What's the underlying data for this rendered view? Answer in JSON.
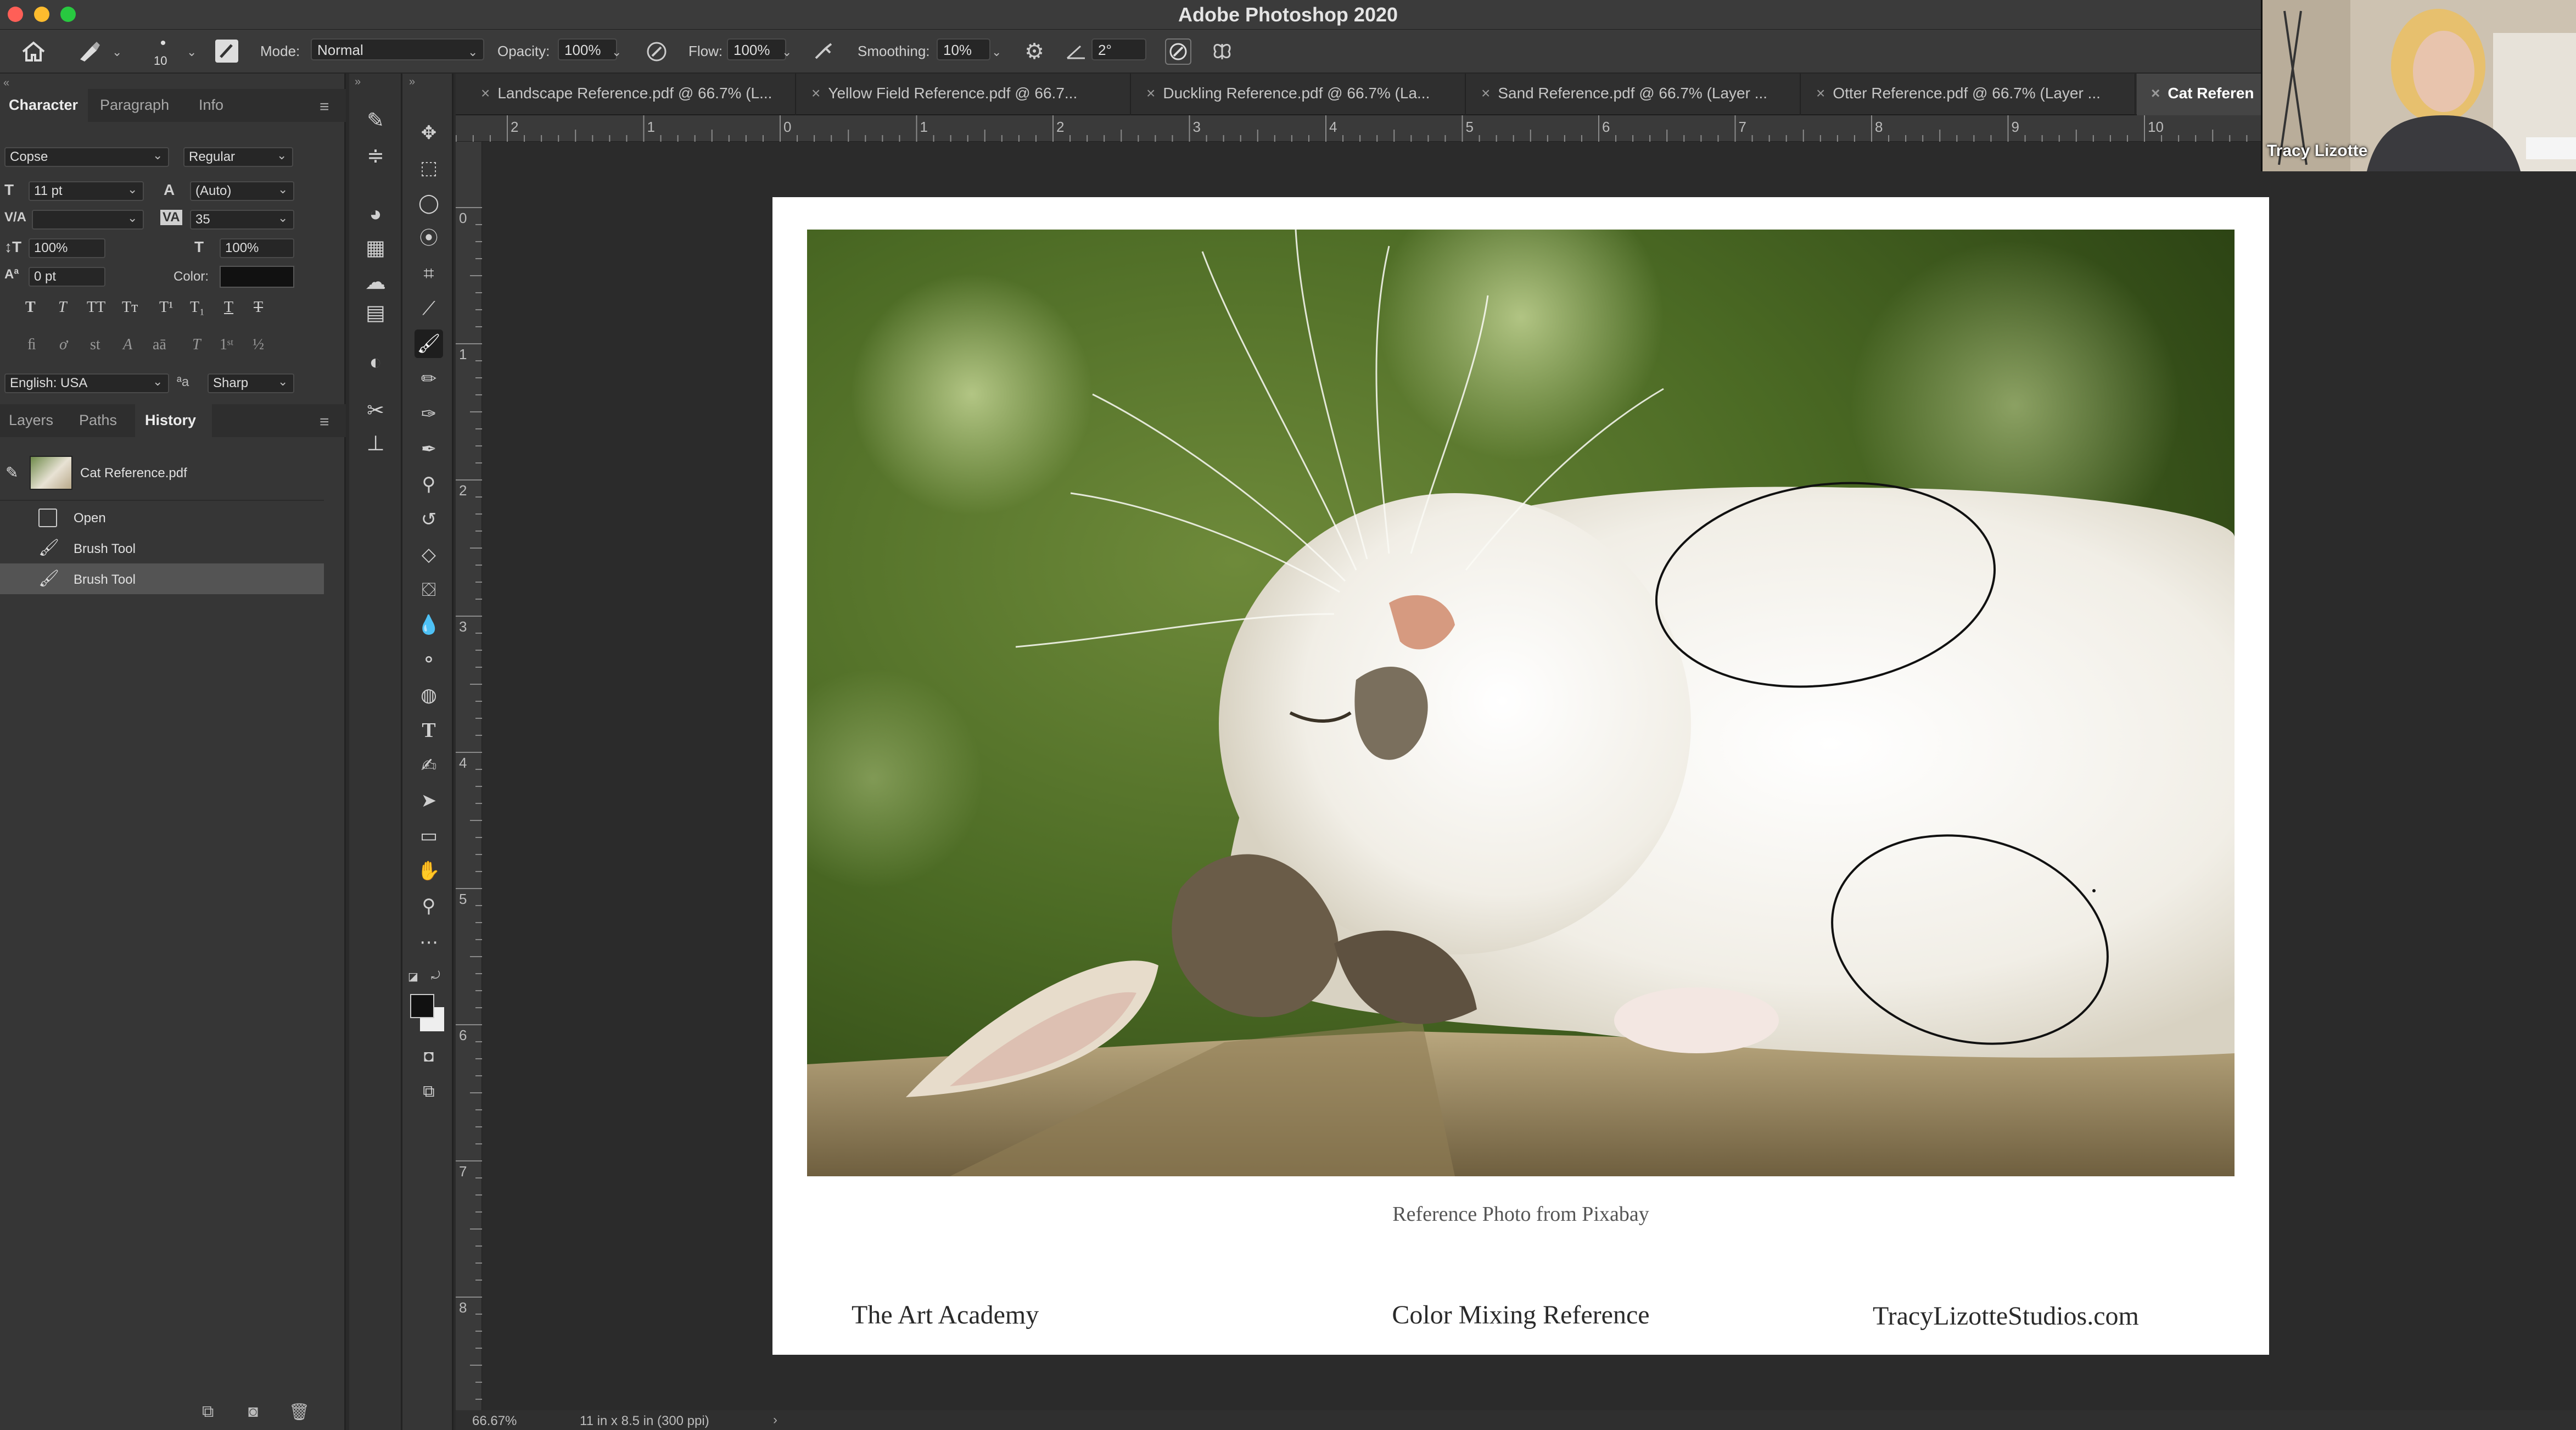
{
  "app": {
    "title": "Adobe Photoshop 2020"
  },
  "options_bar": {
    "brush_size": "10",
    "mode_label": "Mode:",
    "mode_value": "Normal",
    "opacity_label": "Opacity:",
    "opacity_value": "100%",
    "flow_label": "Flow:",
    "flow_value": "100%",
    "smoothing_label": "Smoothing:",
    "smoothing_value": "10%",
    "angle_value": "2°"
  },
  "character_panel": {
    "tabs": [
      "Character",
      "Paragraph",
      "Info"
    ],
    "font_family": "Copse",
    "font_style": "Regular",
    "font_size": "11 pt",
    "leading": "(Auto)",
    "kerning": "",
    "tracking": "35",
    "vertical_scale": "100%",
    "horizontal_scale": "100%",
    "baseline_shift": "0 pt",
    "color_label": "Color:",
    "language": "English: USA",
    "antialias_prefix": "ªa",
    "antialias": "Sharp"
  },
  "history_panel": {
    "tabs": [
      "Layers",
      "Paths",
      "History"
    ],
    "snapshot": "Cat Reference.pdf",
    "items": [
      "Open",
      "Brush Tool",
      "Brush Tool"
    ]
  },
  "document_tabs": [
    "Landscape Reference.pdf @ 66.7% (L...",
    "Yellow Field Reference.pdf @ 66.7...",
    "Duckling Reference.pdf @ 66.7% (La...",
    "Sand Reference.pdf @ 66.7% (Layer ...",
    "Otter Reference.pdf @ 66.7% (Layer ...",
    "Cat Referen"
  ],
  "ruler": {
    "h_ticks": [
      "2",
      "1",
      "0",
      "1",
      "2",
      "3",
      "4",
      "5",
      "6",
      "7",
      "8",
      "9",
      "10"
    ],
    "v_ticks": [
      "0",
      "1",
      "2",
      "3",
      "4",
      "5",
      "6",
      "7",
      "8"
    ]
  },
  "document": {
    "caption_top": "Reference Photo from Pixabay",
    "footer_left": "The Art Academy",
    "footer_center": "Color Mixing Reference",
    "footer_right": "TracyLizotteStudios.com"
  },
  "status_bar": {
    "zoom": "66.67%",
    "doc_info": "11 in x 8.5 in (300 ppi)"
  },
  "webcam": {
    "name": "Tracy Lizotte"
  },
  "colors": {
    "accent_close": "#ff5f57",
    "accent_min": "#febc2e",
    "accent_max": "#28c840",
    "panel_bg": "#363636",
    "canvas_bg": "#2b2b2b"
  }
}
